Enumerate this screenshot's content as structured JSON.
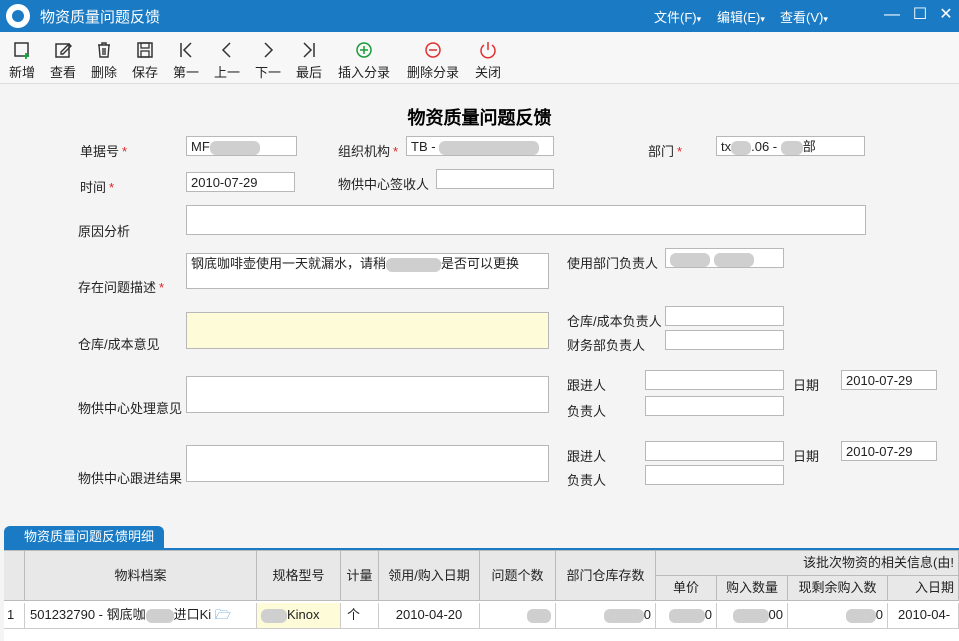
{
  "window": {
    "title": "物资质量问题反馈",
    "menus": [
      "文件(F)",
      "编辑(E)",
      "查看(V)"
    ]
  },
  "toolbar": [
    {
      "label": "新增",
      "icon": "add-icon"
    },
    {
      "label": "查看",
      "icon": "edit-icon"
    },
    {
      "label": "删除",
      "icon": "trash-icon"
    },
    {
      "label": "保存",
      "icon": "save-icon"
    },
    {
      "label": "第一",
      "icon": "first-icon"
    },
    {
      "label": "上一",
      "icon": "prev-icon"
    },
    {
      "label": "下一",
      "icon": "next-icon"
    },
    {
      "label": "最后",
      "icon": "last-icon"
    },
    {
      "label": "插入分录",
      "icon": "plus-circle-icon"
    },
    {
      "label": "删除分录",
      "icon": "minus-circle-icon"
    },
    {
      "label": "关闭",
      "icon": "power-icon"
    }
  ],
  "form": {
    "title": "物资质量问题反馈",
    "doc_no_label": "单据号",
    "doc_no_value": "MF",
    "org_label": "组织机构",
    "org_value": "TB -",
    "dept_label": "部门",
    "dept_value": "tx",
    "dept_value_mid": ".06 -",
    "dept_value_end": "部",
    "time_label": "时间",
    "time_value": "2010-07-29",
    "receiver_label": "物供中心签收人",
    "receiver_value": "",
    "cause_label": "原因分析",
    "cause_value": "",
    "problem_label": "存在问题描述",
    "problem_value_a": "钢底咖啡壶使用一天就漏水，请稍",
    "problem_value_b": "是否可以更换",
    "user_mgr_label": "使用部门负责人",
    "warehouse_label": "仓库/成本意见",
    "warehouse_value": "",
    "wh_mgr_label": "仓库/成本负责人",
    "wh_mgr_value": "",
    "fin_mgr_label": "财务部负责人",
    "fin_mgr_value": "",
    "process_label": "物供中心处理意见",
    "process_value": "",
    "follow_label": "跟进人",
    "follow_value": "",
    "date_label": "日期",
    "date_value": "2010-07-29",
    "owner_label": "负责人",
    "owner_value": "",
    "result_label": "物供中心跟进结果",
    "result_value": "",
    "follow2_label": "跟进人",
    "follow2_value": "",
    "date2_label": "日期",
    "date2_value": "2010-07-29",
    "owner2_label": "负责人",
    "owner2_value": ""
  },
  "detail": {
    "tab": "物资质量问题反馈明细",
    "headers": {
      "material": "物料档案",
      "spec": "规格型号",
      "unit": "计量",
      "date": "领用/购入日期",
      "count": "问题个数",
      "stock": "部门仓库存数",
      "group": "该批次物资的相关信息(由!",
      "price": "单价",
      "qty": "购入数量",
      "remain": "现剩余购入数",
      "buydate": "入日期"
    },
    "row": {
      "no": "1",
      "material": "501232790 - 钢底咖",
      "material_tail": "进口Ki",
      "spec": "Kinox",
      "unit": "个",
      "date": "2010-04-20",
      "stock": "0",
      "price": "0",
      "qty": "00",
      "remain": "0",
      "buydate": "2010-04-"
    }
  }
}
